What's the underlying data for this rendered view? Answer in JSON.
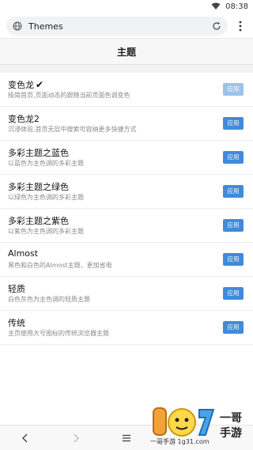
{
  "status_bar": {
    "time": "08:38"
  },
  "address_bar": {
    "url": "Themes"
  },
  "page": {
    "title": "主题"
  },
  "themes": [
    {
      "name": "变色龙",
      "checked": true,
      "desc": "极简首页,页面动态的跟随当前页面色调变色",
      "button": "应用",
      "disabled": true
    },
    {
      "name": "变色龙2",
      "checked": false,
      "desc": "沉浸体验,首页无层中搜索可容纳更多快捷方式",
      "button": "应用",
      "disabled": false
    },
    {
      "name": "多彩主题之蓝色",
      "checked": false,
      "desc": "以蓝色为主色调的多彩主题",
      "button": "应用",
      "disabled": false
    },
    {
      "name": "多彩主题之绿色",
      "checked": false,
      "desc": "以绿色为主色调的多彩主题",
      "button": "应用",
      "disabled": false
    },
    {
      "name": "多彩主题之紫色",
      "checked": false,
      "desc": "以紫色为主色调的多彩主题",
      "button": "应用",
      "disabled": false
    },
    {
      "name": "Almost",
      "checked": false,
      "desc": "黑色和白色的Almost主题，更加省电",
      "button": "应用",
      "disabled": false
    },
    {
      "name": "轻质",
      "checked": false,
      "desc": "白色灰色为主色调的轻质主题",
      "button": "应用",
      "disabled": false
    },
    {
      "name": "传统",
      "checked": false,
      "desc": "主页使用大号图标的传统浏览器主题",
      "button": "应用",
      "disabled": false
    }
  ],
  "watermark": {
    "top": "一哥",
    "bottom": "手游",
    "url": "一哥手游 1g31.com"
  },
  "colors": {
    "accent": "#3e8bdc",
    "accent_disabled": "#9cc3ec"
  }
}
